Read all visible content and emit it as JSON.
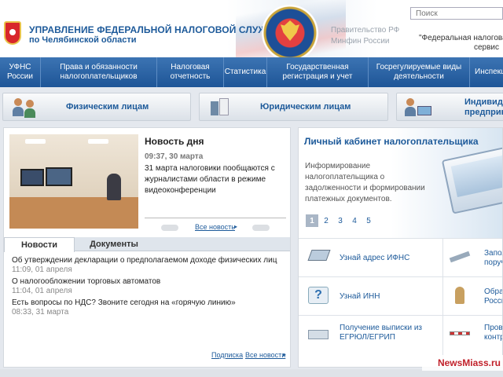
{
  "header": {
    "org_title": "УПРАВЛЕНИЕ ФЕДЕРАЛЬНОЙ НАЛОГОВОЙ СЛУЖБЫ",
    "org_subtitle": "по Челябинской области",
    "links": [
      "Правительство РФ",
      "Минфин России"
    ],
    "search_placeholder": "Поиск",
    "quote_line1": "\"Федеральная налоговая",
    "quote_line2": "сервис"
  },
  "nav": {
    "items": [
      {
        "label": "УФНС\nРоссии"
      },
      {
        "label": "Права и обязанности\nналогоплательщиков"
      },
      {
        "label": "Налоговая\nотчетность"
      },
      {
        "label": "Статистика"
      },
      {
        "label": "Государственная\nрегистрация и учет"
      },
      {
        "label": "Госрегулируемые виды\nдеятельности"
      },
      {
        "label": "Инспекц"
      }
    ]
  },
  "categories": [
    {
      "label": "Физическим лицам"
    },
    {
      "label": "Юридическим лицам"
    },
    {
      "label": "Индивид\nпредприн"
    }
  ],
  "news_day": {
    "title": "Новость дня",
    "time": "09:37, 30 марта",
    "text": "31 марта налоговики пообщаются с журналистами области в режиме видеоконференции",
    "all_news": "Все новость"
  },
  "tabs": [
    {
      "label": "Новости",
      "active": true
    },
    {
      "label": "Документы",
      "active": false
    }
  ],
  "news": [
    {
      "title": "Об утверждении декларации о предполагаемом доходе физических лиц",
      "time": "11:09, 01 апреля"
    },
    {
      "title": "О налогообложении торговых автоматов",
      "time": "11:04, 01 апреля"
    },
    {
      "title": "Есть вопросы по НДС? Звоните сегодня на «горячую линию»",
      "time": "08:33, 31 марта"
    }
  ],
  "footer_links": {
    "subscribe": "Подписка",
    "all_news": "Все новости"
  },
  "cabinet": {
    "title": "Личный кабинет налогоплательщика",
    "text": "Информирование налогоплательщика о задолженности и формировании платежных документов.",
    "pages": [
      "1",
      "2",
      "3",
      "4",
      "5"
    ],
    "active_page": "1"
  },
  "services": [
    {
      "label": "Узнай адрес ИФНС",
      "icon": "laptop-icon"
    },
    {
      "label": "Запол\nпоруч",
      "icon": "ruler-icon"
    },
    {
      "label": "Узнай ИНН",
      "icon": "question-icon"
    },
    {
      "label": "Обращ\nРосси",
      "icon": "chess-piece-icon"
    },
    {
      "label": "Получение выписки из\nЕГРЮЛ/ЕГРИП",
      "icon": "scanner-icon"
    },
    {
      "label": "Прове\nконтр",
      "icon": "barrier-icon"
    }
  ],
  "watermark": "NewsMiass.ru",
  "colors": {
    "brand": "#1d5a9a",
    "nav": "#2a62a5",
    "crest_red": "#d8262b"
  }
}
